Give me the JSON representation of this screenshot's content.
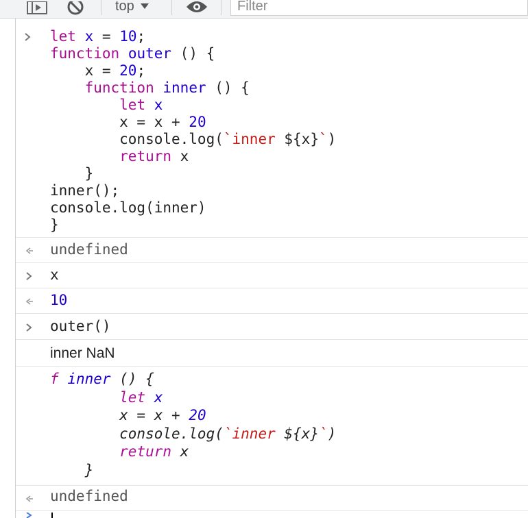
{
  "toolbar": {
    "context": "top",
    "filter_placeholder": "Filter",
    "icons": [
      "sidebar-toggle-icon",
      "clear-console-icon",
      "dropdown-caret-icon",
      "eye-icon"
    ]
  },
  "console": {
    "entry1": {
      "lines": [
        "let x = 10;",
        "function outer () {",
        "    x = 20;",
        "    function inner () {",
        "        let x",
        "        x = x + 20",
        "        console.log(`inner ${x}`)",
        "        return x",
        "    }",
        "inner();",
        "console.log(inner)",
        "}"
      ],
      "result": "undefined"
    },
    "entry2": {
      "input": "x",
      "result": "10"
    },
    "entry3": {
      "input": "outer()",
      "log1": "inner NaN",
      "log2_lines": [
        "f inner () {",
        "        let x",
        "        x = x + 20",
        "        console.log(`inner ${x}`)",
        "        return x",
        "    }"
      ],
      "result": "undefined"
    }
  }
}
